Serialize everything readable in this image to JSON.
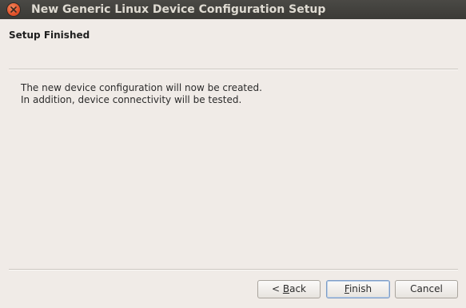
{
  "window": {
    "title": "New Generic Linux Device Configuration Setup"
  },
  "page": {
    "title": "Setup Finished",
    "body_line1": "The new device configuration will now be created.",
    "body_line2": "In addition, device connectivity will be tested."
  },
  "buttons": {
    "back_prefix": "< ",
    "back_mnemonic": "B",
    "back_rest": "ack",
    "finish_mnemonic": "F",
    "finish_rest": "inish",
    "cancel_label": "Cancel"
  },
  "colors": {
    "titlebar": "#3c3b37",
    "background": "#f0ebe7",
    "close_button": "#e2522b"
  },
  "icons": {
    "close": "close-icon"
  }
}
